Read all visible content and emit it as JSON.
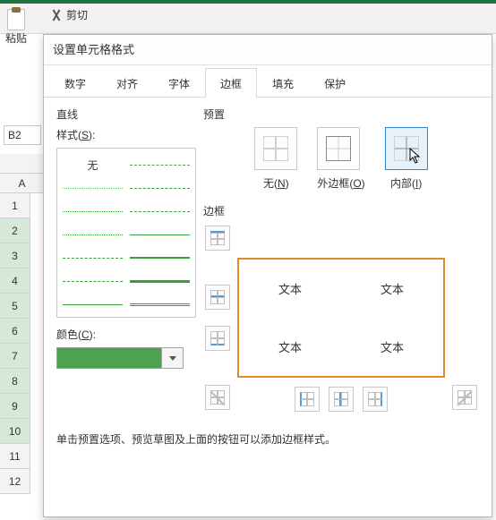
{
  "ribbon": {
    "paste_label": "粘贴",
    "cut_label": "剪切"
  },
  "sheet": {
    "namebox": "B2",
    "col_header": "A",
    "rows": [
      "1",
      "2",
      "3",
      "4",
      "5",
      "6",
      "7",
      "8",
      "9",
      "10",
      "11",
      "12"
    ]
  },
  "dialog": {
    "title": "设置单元格格式",
    "tabs": {
      "number": "数字",
      "alignment": "对齐",
      "font": "字体",
      "border": "边框",
      "fill": "填充",
      "protection": "保护"
    },
    "active_tab": "border",
    "line_section": "直线",
    "style_label_prefix": "样式(",
    "style_label_key": "S",
    "style_label_suffix": "):",
    "style_none": "无",
    "color_label_prefix": "颜色(",
    "color_label_key": "C",
    "color_label_suffix": "):",
    "color_value": "#4ea24f",
    "preset_section": "预置",
    "presets": {
      "none_prefix": "无(",
      "none_key": "N",
      "none_suffix": ")",
      "outer_prefix": "外边框(",
      "outer_key": "O",
      "outer_suffix": ")",
      "inner_prefix": "内部(",
      "inner_key": "I",
      "inner_suffix": ")"
    },
    "border_section": "边框",
    "preview_text": "文本",
    "hint": "单击预置选项、预览草图及上面的按钮可以添加边框样式。"
  }
}
